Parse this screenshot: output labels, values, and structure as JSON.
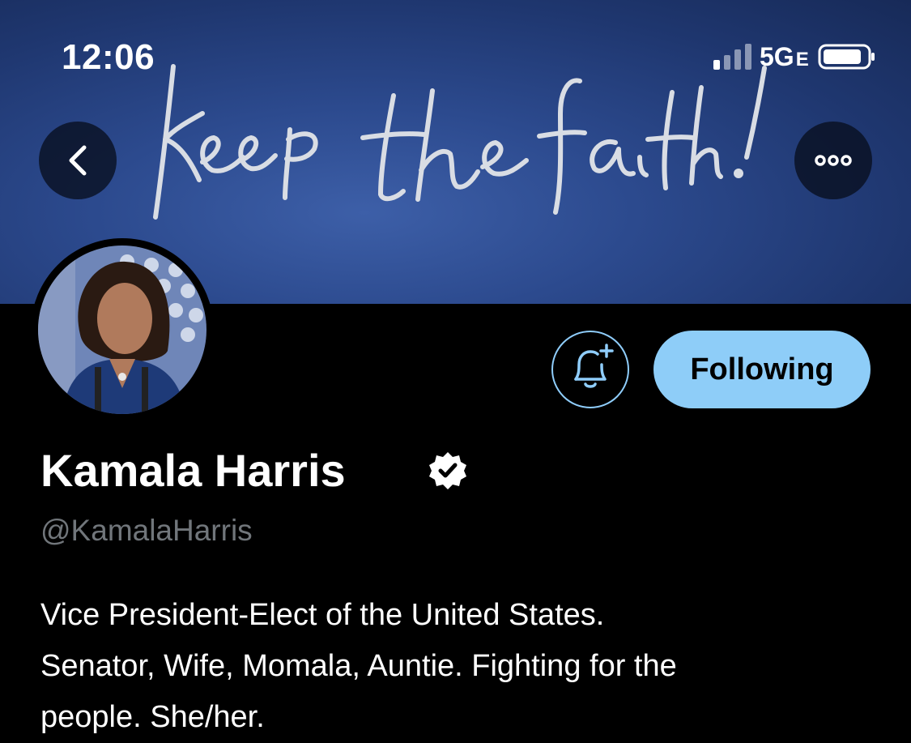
{
  "status_bar": {
    "time": "12:06",
    "network": "5G",
    "network_suffix": "E"
  },
  "banner": {
    "handwriting": "keep the faith!",
    "back_icon": "chevron-left-icon",
    "more_icon": "ellipsis-icon"
  },
  "profile": {
    "name": "Kamala Harris",
    "handle": "@KamalaHarris",
    "verified_icon": "verified-badge-icon",
    "bio_lines": [
      "Vice President-Elect of the United States.",
      "Senator, Wife, Momala, Auntie. Fighting for the",
      "people. She/her."
    ]
  },
  "actions": {
    "notify_icon": "bell-plus-icon",
    "follow_label": "Following"
  },
  "colors": {
    "background": "#000000",
    "accent": "#8ecdf8",
    "secondary_text": "#71767b",
    "banner": "#2c4a8e"
  }
}
